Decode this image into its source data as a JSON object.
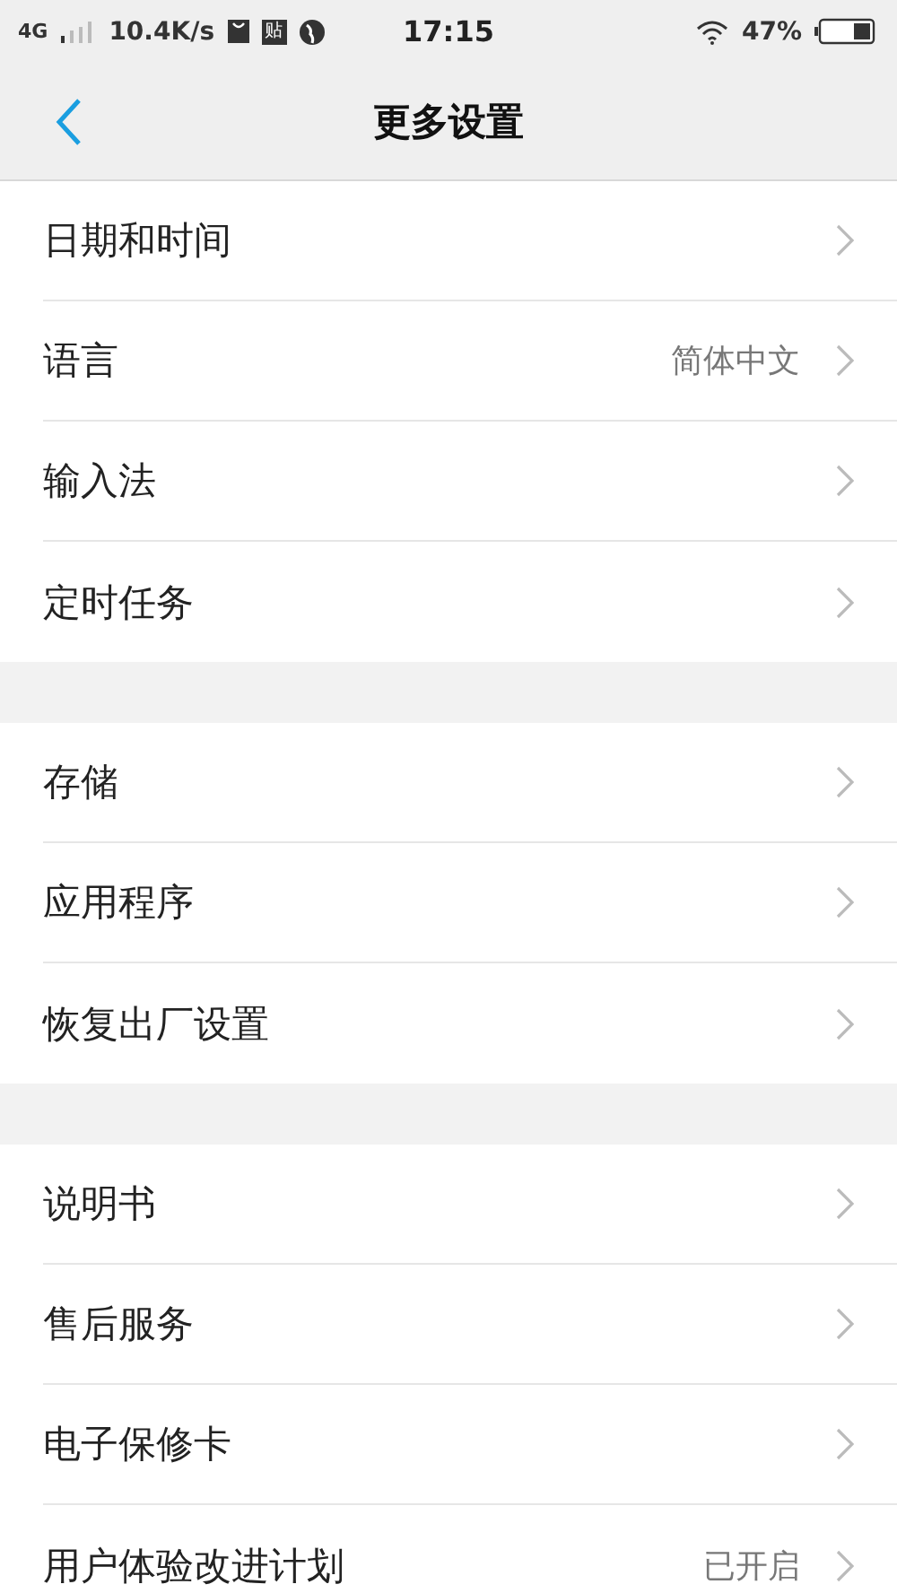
{
  "status_bar": {
    "network": "4G",
    "speed": "10.4K/s",
    "app_badge": "贴",
    "time": "17:15",
    "battery": "47%"
  },
  "header": {
    "title": "更多设置"
  },
  "sections": [
    {
      "items": [
        {
          "label": "日期和时间"
        },
        {
          "label": "语言",
          "value": "简体中文"
        },
        {
          "label": "输入法"
        },
        {
          "label": "定时任务"
        }
      ]
    },
    {
      "items": [
        {
          "label": "存储"
        },
        {
          "label": "应用程序"
        },
        {
          "label": "恢复出厂设置"
        }
      ]
    },
    {
      "items": [
        {
          "label": "说明书"
        },
        {
          "label": "售后服务"
        },
        {
          "label": "电子保修卡"
        },
        {
          "label": "用户体验改进计划",
          "value": "已开启"
        }
      ]
    }
  ]
}
